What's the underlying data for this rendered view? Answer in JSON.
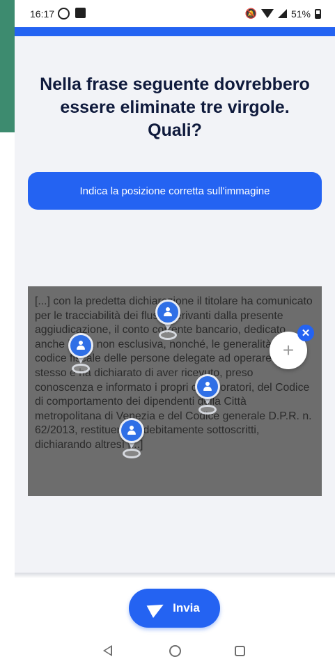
{
  "status_bar": {
    "time": "16:17",
    "battery": "51%"
  },
  "quiz": {
    "question": "Nella frase seguente dovrebbero essere eliminate tre virgole. Quali?",
    "instruction_button": "Indica la posizione corretta sull'immagine",
    "image_text": "[...] con la predetta dichiarazione il titolare ha comunicato per le tracciabilità dei flussi derivanti dalla presente aggiudicazione, il conto corrente bancario, dedicato anche in via non esclusiva, nonché, le generalità ed il codice fiscale delle persone delegate ad operare sullo stesso e ha dichiarato di aver ricevuto, preso conoscenza e informato i propri collaboratori, del Codice di comportamento dei dipendenti della Città metropolitana di Venezia e del Codice generale D.P.R. n. 62/2013, restituendoli debitamente sottoscritti, dichiarando altresì [...]",
    "markers_count": 4
  },
  "submit": {
    "label": "Invia"
  },
  "colors": {
    "primary": "#2463f2",
    "panel_bg": "#f2f3f7",
    "title": "#0f1a3c",
    "side_accent": "#3d8b6f"
  },
  "icons": {
    "marker": "person-pin-icon",
    "send": "paper-plane-icon",
    "close": "close-icon",
    "cursor": "plus-icon"
  }
}
